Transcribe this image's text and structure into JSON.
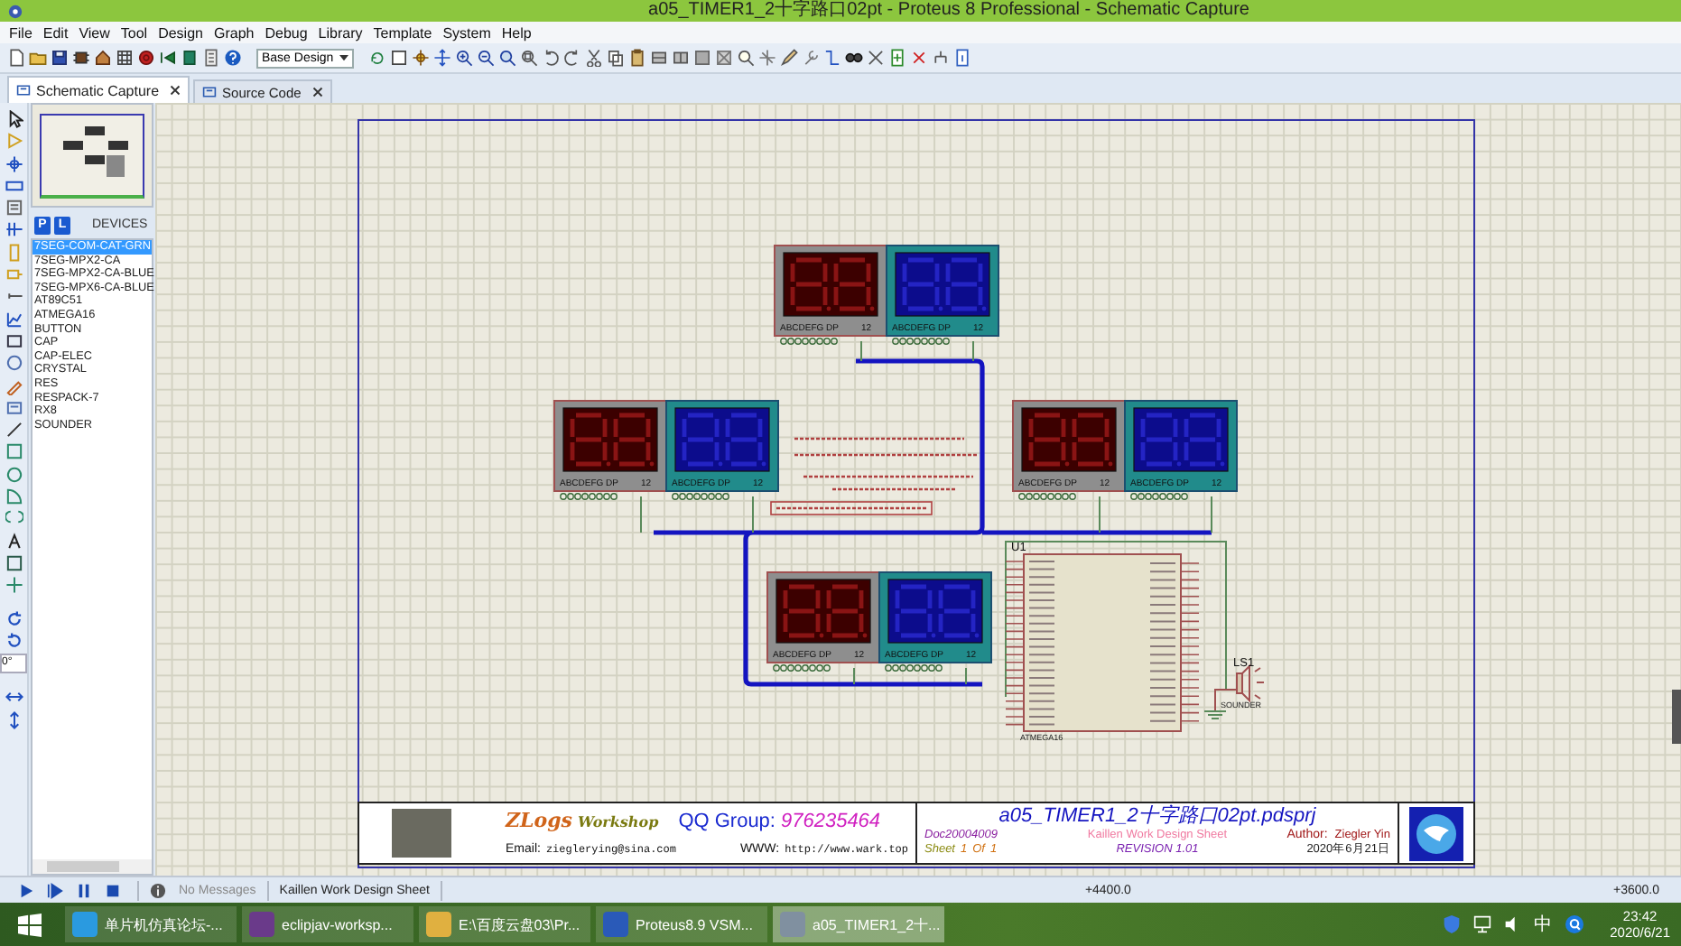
{
  "window": {
    "title": "a05_TIMER1_2十字路口02pt - Proteus 8 Professional - Schematic Capture"
  },
  "menu": [
    "File",
    "Edit",
    "View",
    "Tool",
    "Design",
    "Graph",
    "Debug",
    "Library",
    "Template",
    "System",
    "Help"
  ],
  "toolbar": {
    "variant": "Base Design"
  },
  "tabs": [
    {
      "label": "Schematic Capture",
      "selected": true
    },
    {
      "label": "Source Code",
      "selected": false
    }
  ],
  "devices": {
    "p": "P",
    "l": "L",
    "header": "DEVICES",
    "items": [
      {
        "label": "7SEG-COM-CAT-GRN",
        "selected": true
      },
      {
        "label": "7SEG-MPX2-CA",
        "selected": false
      },
      {
        "label": "7SEG-MPX2-CA-BLUE",
        "selected": false
      },
      {
        "label": "7SEG-MPX6-CA-BLUE",
        "selected": false
      },
      {
        "label": "AT89C51",
        "selected": false
      },
      {
        "label": "ATMEGA16",
        "selected": false
      },
      {
        "label": "BUTTON",
        "selected": false
      },
      {
        "label": "CAP",
        "selected": false
      },
      {
        "label": "CAP-ELEC",
        "selected": false
      },
      {
        "label": "CRYSTAL",
        "selected": false
      },
      {
        "label": "RES",
        "selected": false
      },
      {
        "label": "RESPACK-7",
        "selected": false
      },
      {
        "label": "RX8",
        "selected": false
      },
      {
        "label": "SOUNDER",
        "selected": false
      }
    ]
  },
  "rotation": "0°",
  "schematic": {
    "displays": [
      {
        "kind": "red",
        "segments": "ABCDEFG DP",
        "pins": "12"
      },
      {
        "kind": "blue",
        "segments": "ABCDEFG DP",
        "pins": "12"
      },
      {
        "kind": "red",
        "segments": "ABCDEFG DP",
        "pins": "12"
      },
      {
        "kind": "blue",
        "segments": "ABCDEFG DP",
        "pins": "12"
      },
      {
        "kind": "red",
        "segments": "ABCDEFG DP",
        "pins": "12"
      },
      {
        "kind": "blue",
        "segments": "ABCDEFG DP",
        "pins": "12"
      },
      {
        "kind": "red",
        "segments": "ABCDEFG DP",
        "pins": "12"
      },
      {
        "kind": "blue",
        "segments": "ABCDEFG DP",
        "pins": "12"
      }
    ],
    "mcu": {
      "ref": "U1",
      "part": "ATMEGA16"
    },
    "sounder": {
      "ref": "LS1",
      "part": "SOUNDER"
    }
  },
  "title_block": {
    "brand": "ZLogs",
    "brand2": "Workshop",
    "qq_label": "QQ Group:",
    "qq": "976235464",
    "email_label": "Email:",
    "email": "zieglerying@sina.com",
    "www_label": "WWW:",
    "www": "http://www.wark.top",
    "project": "a05_TIMER1_2十字路口02pt.pdsprj",
    "doc": "Doc20004009",
    "design": "Kaillen Work Design Sheet",
    "author_label": "Author:",
    "author": "Ziegler Yin",
    "sheet_label": "Sheet",
    "sheet": "1",
    "of_label": "Of",
    "of": "1",
    "revision": "REVISION 1.01",
    "date": "2020年6月21日"
  },
  "status_bar": {
    "messages": "No Messages",
    "sheet": "Kaillen Work Design Sheet",
    "x": "+4400.0",
    "y": "+3600.0"
  },
  "taskbar": {
    "items": [
      {
        "label": "单片机仿真论坛-...",
        "selected": false
      },
      {
        "label": "eclipjav-worksp...",
        "selected": false
      },
      {
        "label": "E:\\百度云盘03\\Pr...",
        "selected": false
      },
      {
        "label": "Proteus8.9 VSM...",
        "selected": false
      },
      {
        "label": "a05_TIMER1_2十...",
        "selected": true
      }
    ],
    "ime": "中",
    "time": "23:42",
    "date": "2020/6/21"
  }
}
